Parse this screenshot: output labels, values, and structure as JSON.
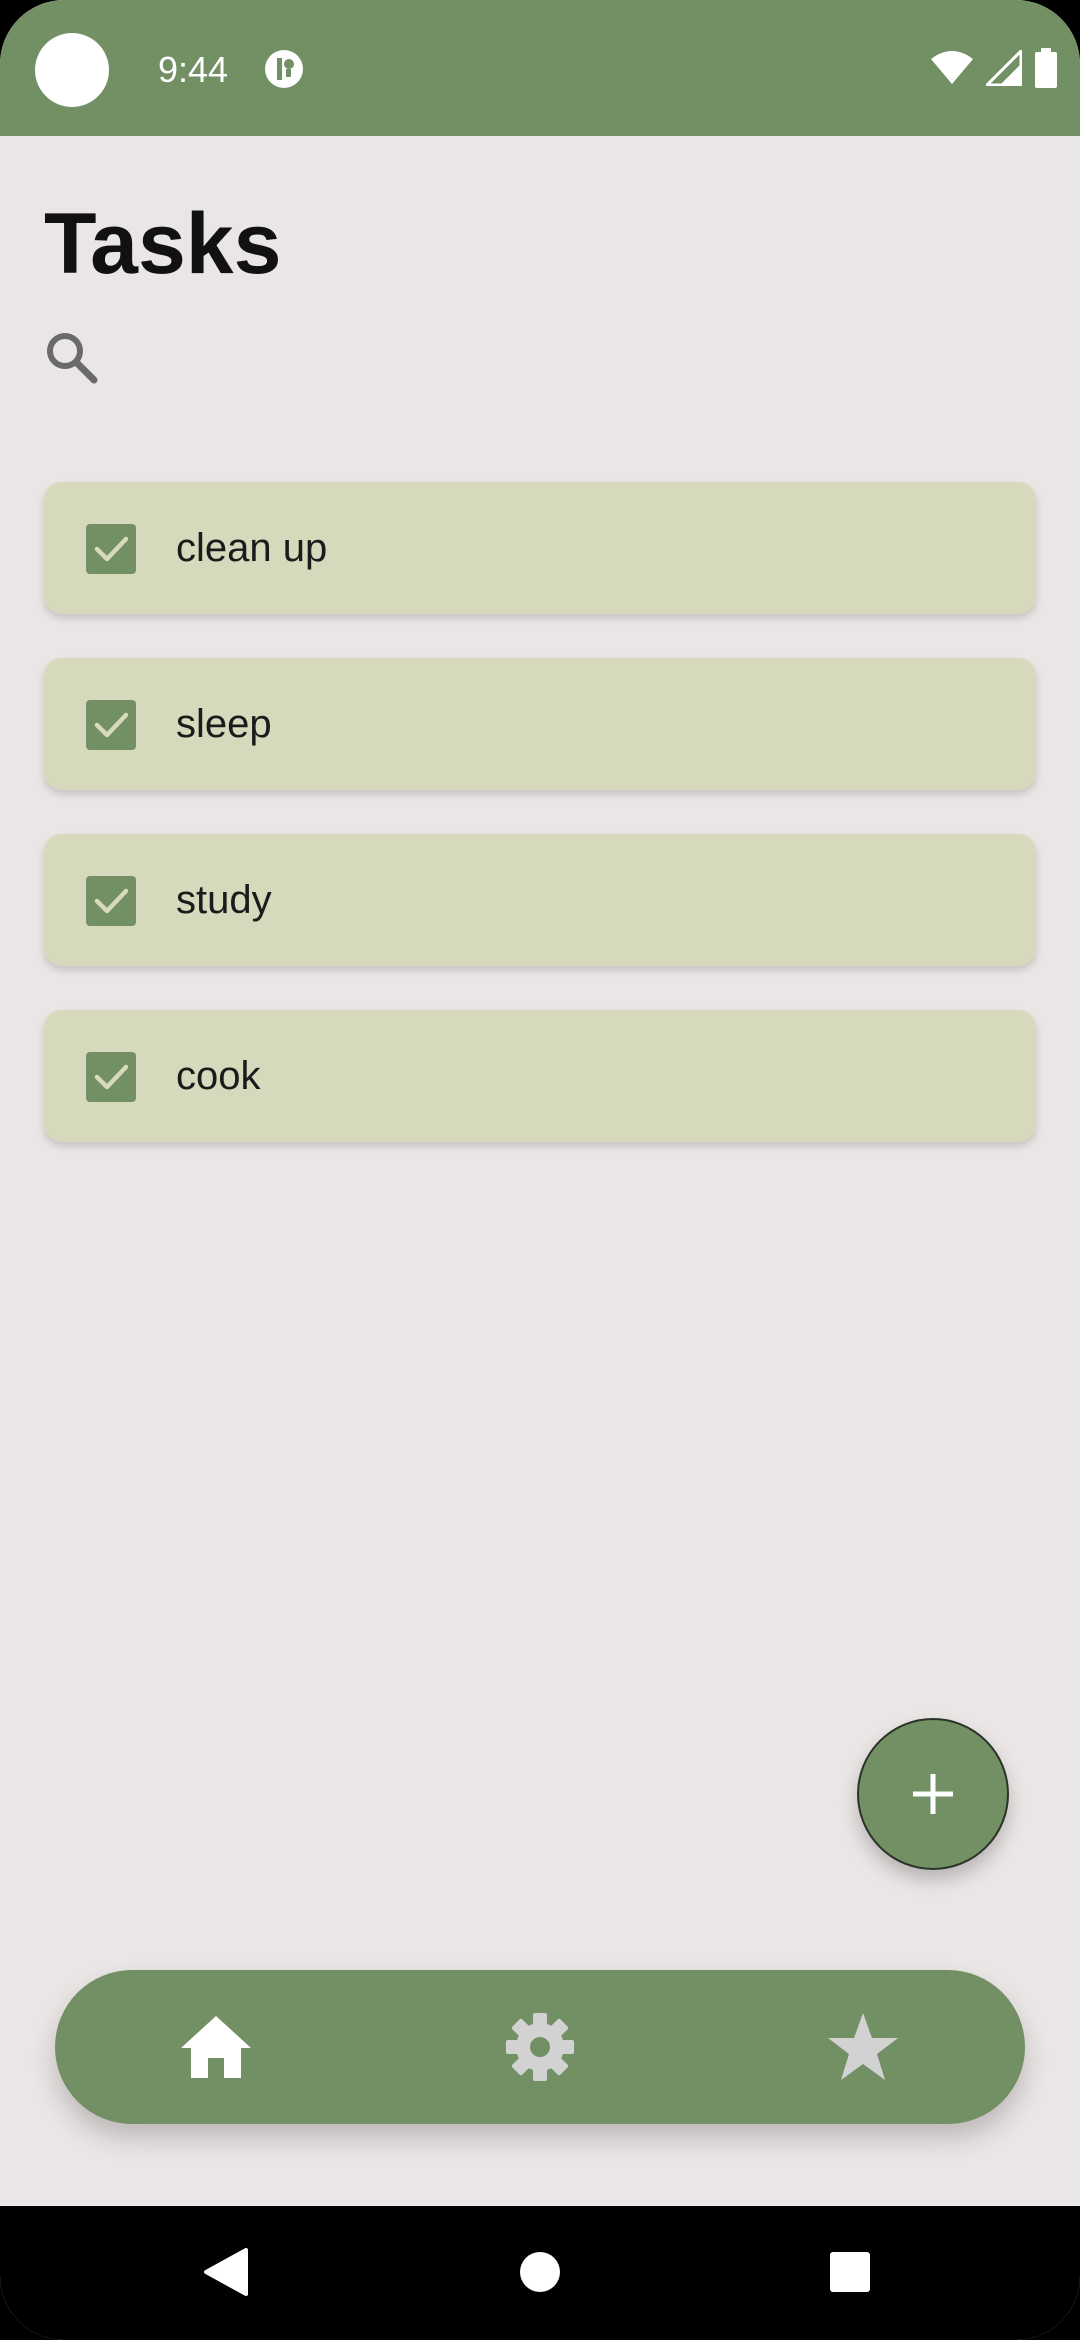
{
  "status_bar": {
    "time": "9:44",
    "background_color": "#738f64",
    "icons": [
      "camera-dot",
      "app-notification-icon",
      "wifi-icon",
      "cell-signal-icon",
      "battery-icon"
    ]
  },
  "header": {
    "title": "Tasks",
    "search_icon": "search-icon"
  },
  "tasks": [
    {
      "label": "clean up",
      "checked": true
    },
    {
      "label": "sleep",
      "checked": true
    },
    {
      "label": "study",
      "checked": true
    },
    {
      "label": "cook",
      "checked": true
    }
  ],
  "fab": {
    "icon": "plus-icon",
    "color": "#738f64"
  },
  "bottom_nav": {
    "items": [
      {
        "icon": "home-icon",
        "active": true
      },
      {
        "icon": "gear-icon",
        "active": false
      },
      {
        "icon": "star-icon",
        "active": false
      }
    ],
    "color": "#738f64",
    "active_icon_color": "#ffffff",
    "inactive_icon_color": "#d2d2d2"
  },
  "system_nav": {
    "items": [
      "back-icon",
      "home-circle-icon",
      "recents-icon"
    ]
  },
  "colors": {
    "accent": "#738f64",
    "card": "#d7d9bd",
    "background": "#ebe6e6"
  }
}
